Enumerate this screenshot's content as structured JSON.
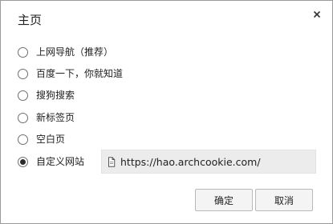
{
  "dialog": {
    "title": "主页",
    "close_icon": "close-icon"
  },
  "options": [
    {
      "label": "上网导航（推荐）",
      "checked": false
    },
    {
      "label": "百度一下，你就知道",
      "checked": false
    },
    {
      "label": "搜狗搜索",
      "checked": false
    },
    {
      "label": "新标签页",
      "checked": false
    },
    {
      "label": "空白页",
      "checked": false
    },
    {
      "label": "自定义网站",
      "checked": true
    }
  ],
  "custom_url": {
    "value": "https://hao.archcookie.com/",
    "icon": "page-icon"
  },
  "buttons": {
    "ok_label": "确定",
    "cancel_label": "取消"
  }
}
